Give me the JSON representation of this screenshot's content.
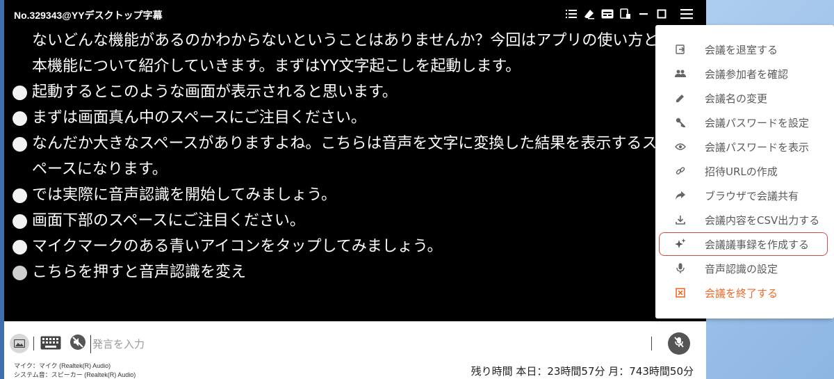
{
  "window": {
    "title": "No.329343@YYデスクトップ字幕"
  },
  "toolbar_icons": [
    "list-icon",
    "eraser-icon",
    "subtitle-icon",
    "pip-icon",
    "minimize-icon",
    "maximize-icon",
    "hamburger-menu-icon"
  ],
  "transcript": [
    {
      "text": "ないどんな機能があるのかわからないということはありませんか？今回はアプリの使い方と",
      "bullet": false
    },
    {
      "text": "本機能について紹介していきます。まずはYY文字起こしを起動します。",
      "bullet": false
    },
    {
      "text": "起動するとこのような画面が表示されると思います。",
      "bullet": true
    },
    {
      "text": "まずは画面真ん中のスペースにご注目ください。",
      "bullet": true
    },
    {
      "text": "なんだか大きなスペースがありますよね。こちらは音声を文字に変換した結果を表示するス",
      "bullet": true
    },
    {
      "text": "ペースになります。",
      "bullet": false
    },
    {
      "text": "では実際に音声認識を開始してみましょう。",
      "bullet": true
    },
    {
      "text": "画面下部のスペースにご注目ください。",
      "bullet": true
    },
    {
      "text": "マイクマークのある青いアイコンをタップしてみましょう。",
      "bullet": true
    },
    {
      "text": "こちらを押すと音声認識を変え",
      "bullet": true,
      "dim": true
    }
  ],
  "input": {
    "placeholder": "発言を入力"
  },
  "audio_info": {
    "mic": "マイク：マイク (Realtek(R) Audio)",
    "system": "システム音：スピーカー (Realtek(R) Audio)"
  },
  "remaining": {
    "text": "残り時間 本日：23時間57分 月：743時間50分"
  },
  "menu": {
    "items": [
      {
        "label": "会議を退室する",
        "icon": "exit-icon"
      },
      {
        "label": "会議参加者を確認",
        "icon": "people-icon"
      },
      {
        "label": "会議名の変更",
        "icon": "pencil-icon"
      },
      {
        "label": "会議パスワードを設定",
        "icon": "key-icon"
      },
      {
        "label": "会議パスワードを表示",
        "icon": "eye-icon"
      },
      {
        "label": "招待URLの作成",
        "icon": "link-icon"
      },
      {
        "label": "ブラウザで会議共有",
        "icon": "share-arrow-icon"
      },
      {
        "label": "会議内容をCSV出力する",
        "icon": "download-icon"
      },
      {
        "label": "会議議事録を作成する",
        "icon": "sparkle-icon",
        "highlighted": true
      },
      {
        "label": "音声認識の設定",
        "icon": "microphone-icon"
      },
      {
        "label": "会議を終了する",
        "icon": "close-box-icon",
        "danger": true
      }
    ]
  },
  "colors": {
    "transcript_bg": "#000000",
    "transcript_text": "#ffffff",
    "menu_text": "#5a5a5a",
    "danger": "#f06a2a",
    "highlight_border": "#d24b4b"
  }
}
